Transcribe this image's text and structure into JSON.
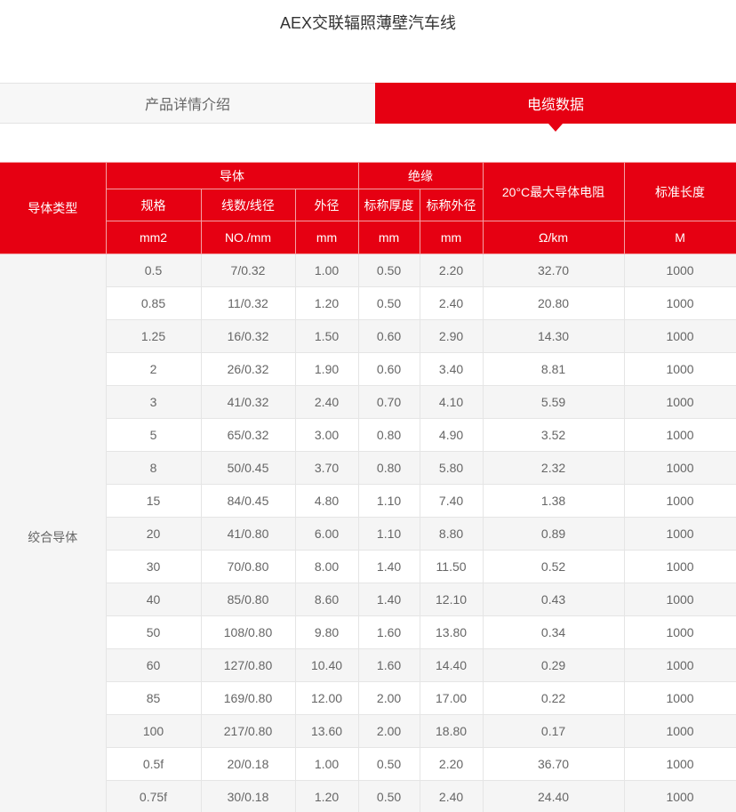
{
  "page": {
    "title": "AEX交联辐照薄壁汽车线"
  },
  "tabs": {
    "intro": "产品详情介绍",
    "data": "电缆数据"
  },
  "table": {
    "header": {
      "conductor_type": "导体类型",
      "conductor": "导体",
      "insulation": "绝缘",
      "resistance": "20°C最大导体电阻",
      "std_length": "标准长度",
      "spec": "规格",
      "strands": "线数/线径",
      "outer_diameter": "外径",
      "nominal_thickness": "标称厚度",
      "nominal_outer": "标称外径",
      "units": [
        "mm2",
        "NO./mm",
        "mm",
        "mm",
        "mm",
        "Ω/km",
        "M"
      ]
    },
    "type_label": "绞合导体",
    "rows": [
      [
        "0.5",
        "7/0.32",
        "1.00",
        "0.50",
        "2.20",
        "32.70",
        "1000"
      ],
      [
        "0.85",
        "11/0.32",
        "1.20",
        "0.50",
        "2.40",
        "20.80",
        "1000"
      ],
      [
        "1.25",
        "16/0.32",
        "1.50",
        "0.60",
        "2.90",
        "14.30",
        "1000"
      ],
      [
        "2",
        "26/0.32",
        "1.90",
        "0.60",
        "3.40",
        "8.81",
        "1000"
      ],
      [
        "3",
        "41/0.32",
        "2.40",
        "0.70",
        "4.10",
        "5.59",
        "1000"
      ],
      [
        "5",
        "65/0.32",
        "3.00",
        "0.80",
        "4.90",
        "3.52",
        "1000"
      ],
      [
        "8",
        "50/0.45",
        "3.70",
        "0.80",
        "5.80",
        "2.32",
        "1000"
      ],
      [
        "15",
        "84/0.45",
        "4.80",
        "1.10",
        "7.40",
        "1.38",
        "1000"
      ],
      [
        "20",
        "41/0.80",
        "6.00",
        "1.10",
        "8.80",
        "0.89",
        "1000"
      ],
      [
        "30",
        "70/0.80",
        "8.00",
        "1.40",
        "11.50",
        "0.52",
        "1000"
      ],
      [
        "40",
        "85/0.80",
        "8.60",
        "1.40",
        "12.10",
        "0.43",
        "1000"
      ],
      [
        "50",
        "108/0.80",
        "9.80",
        "1.60",
        "13.80",
        "0.34",
        "1000"
      ],
      [
        "60",
        "127/0.80",
        "10.40",
        "1.60",
        "14.40",
        "0.29",
        "1000"
      ],
      [
        "85",
        "169/0.80",
        "12.00",
        "2.00",
        "17.00",
        "0.22",
        "1000"
      ],
      [
        "100",
        "217/0.80",
        "13.60",
        "2.00",
        "18.80",
        "0.17",
        "1000"
      ],
      [
        "0.5f",
        "20/0.18",
        "1.00",
        "0.50",
        "2.20",
        "36.70",
        "1000"
      ],
      [
        "0.75f",
        "30/0.18",
        "1.20",
        "0.50",
        "2.40",
        "24.40",
        "1000"
      ]
    ]
  },
  "colors": {
    "accent": "#e60012",
    "row_alt": "#f5f5f5",
    "border": "#e5e5e5"
  }
}
